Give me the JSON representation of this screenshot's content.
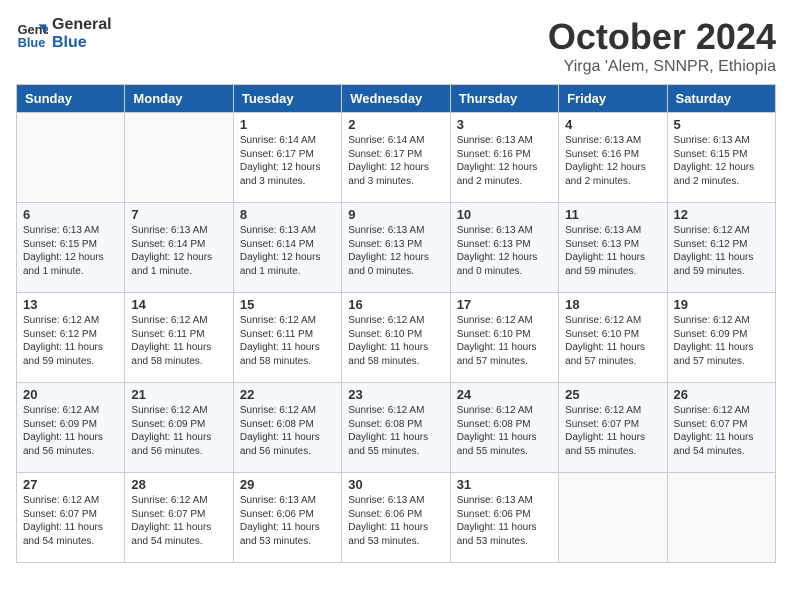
{
  "logo": {
    "line1": "General",
    "line2": "Blue"
  },
  "title": "October 2024",
  "location": "Yirga 'Alem, SNNPR, Ethiopia",
  "days_of_week": [
    "Sunday",
    "Monday",
    "Tuesday",
    "Wednesday",
    "Thursday",
    "Friday",
    "Saturday"
  ],
  "weeks": [
    [
      {
        "day": "",
        "info": ""
      },
      {
        "day": "",
        "info": ""
      },
      {
        "day": "1",
        "info": "Sunrise: 6:14 AM\nSunset: 6:17 PM\nDaylight: 12 hours and 3 minutes."
      },
      {
        "day": "2",
        "info": "Sunrise: 6:14 AM\nSunset: 6:17 PM\nDaylight: 12 hours and 3 minutes."
      },
      {
        "day": "3",
        "info": "Sunrise: 6:13 AM\nSunset: 6:16 PM\nDaylight: 12 hours and 2 minutes."
      },
      {
        "day": "4",
        "info": "Sunrise: 6:13 AM\nSunset: 6:16 PM\nDaylight: 12 hours and 2 minutes."
      },
      {
        "day": "5",
        "info": "Sunrise: 6:13 AM\nSunset: 6:15 PM\nDaylight: 12 hours and 2 minutes."
      }
    ],
    [
      {
        "day": "6",
        "info": "Sunrise: 6:13 AM\nSunset: 6:15 PM\nDaylight: 12 hours and 1 minute."
      },
      {
        "day": "7",
        "info": "Sunrise: 6:13 AM\nSunset: 6:14 PM\nDaylight: 12 hours and 1 minute."
      },
      {
        "day": "8",
        "info": "Sunrise: 6:13 AM\nSunset: 6:14 PM\nDaylight: 12 hours and 1 minute."
      },
      {
        "day": "9",
        "info": "Sunrise: 6:13 AM\nSunset: 6:13 PM\nDaylight: 12 hours and 0 minutes."
      },
      {
        "day": "10",
        "info": "Sunrise: 6:13 AM\nSunset: 6:13 PM\nDaylight: 12 hours and 0 minutes."
      },
      {
        "day": "11",
        "info": "Sunrise: 6:13 AM\nSunset: 6:13 PM\nDaylight: 11 hours and 59 minutes."
      },
      {
        "day": "12",
        "info": "Sunrise: 6:12 AM\nSunset: 6:12 PM\nDaylight: 11 hours and 59 minutes."
      }
    ],
    [
      {
        "day": "13",
        "info": "Sunrise: 6:12 AM\nSunset: 6:12 PM\nDaylight: 11 hours and 59 minutes."
      },
      {
        "day": "14",
        "info": "Sunrise: 6:12 AM\nSunset: 6:11 PM\nDaylight: 11 hours and 58 minutes."
      },
      {
        "day": "15",
        "info": "Sunrise: 6:12 AM\nSunset: 6:11 PM\nDaylight: 11 hours and 58 minutes."
      },
      {
        "day": "16",
        "info": "Sunrise: 6:12 AM\nSunset: 6:10 PM\nDaylight: 11 hours and 58 minutes."
      },
      {
        "day": "17",
        "info": "Sunrise: 6:12 AM\nSunset: 6:10 PM\nDaylight: 11 hours and 57 minutes."
      },
      {
        "day": "18",
        "info": "Sunrise: 6:12 AM\nSunset: 6:10 PM\nDaylight: 11 hours and 57 minutes."
      },
      {
        "day": "19",
        "info": "Sunrise: 6:12 AM\nSunset: 6:09 PM\nDaylight: 11 hours and 57 minutes."
      }
    ],
    [
      {
        "day": "20",
        "info": "Sunrise: 6:12 AM\nSunset: 6:09 PM\nDaylight: 11 hours and 56 minutes."
      },
      {
        "day": "21",
        "info": "Sunrise: 6:12 AM\nSunset: 6:09 PM\nDaylight: 11 hours and 56 minutes."
      },
      {
        "day": "22",
        "info": "Sunrise: 6:12 AM\nSunset: 6:08 PM\nDaylight: 11 hours and 56 minutes."
      },
      {
        "day": "23",
        "info": "Sunrise: 6:12 AM\nSunset: 6:08 PM\nDaylight: 11 hours and 55 minutes."
      },
      {
        "day": "24",
        "info": "Sunrise: 6:12 AM\nSunset: 6:08 PM\nDaylight: 11 hours and 55 minutes."
      },
      {
        "day": "25",
        "info": "Sunrise: 6:12 AM\nSunset: 6:07 PM\nDaylight: 11 hours and 55 minutes."
      },
      {
        "day": "26",
        "info": "Sunrise: 6:12 AM\nSunset: 6:07 PM\nDaylight: 11 hours and 54 minutes."
      }
    ],
    [
      {
        "day": "27",
        "info": "Sunrise: 6:12 AM\nSunset: 6:07 PM\nDaylight: 11 hours and 54 minutes."
      },
      {
        "day": "28",
        "info": "Sunrise: 6:12 AM\nSunset: 6:07 PM\nDaylight: 11 hours and 54 minutes."
      },
      {
        "day": "29",
        "info": "Sunrise: 6:13 AM\nSunset: 6:06 PM\nDaylight: 11 hours and 53 minutes."
      },
      {
        "day": "30",
        "info": "Sunrise: 6:13 AM\nSunset: 6:06 PM\nDaylight: 11 hours and 53 minutes."
      },
      {
        "day": "31",
        "info": "Sunrise: 6:13 AM\nSunset: 6:06 PM\nDaylight: 11 hours and 53 minutes."
      },
      {
        "day": "",
        "info": ""
      },
      {
        "day": "",
        "info": ""
      }
    ]
  ]
}
